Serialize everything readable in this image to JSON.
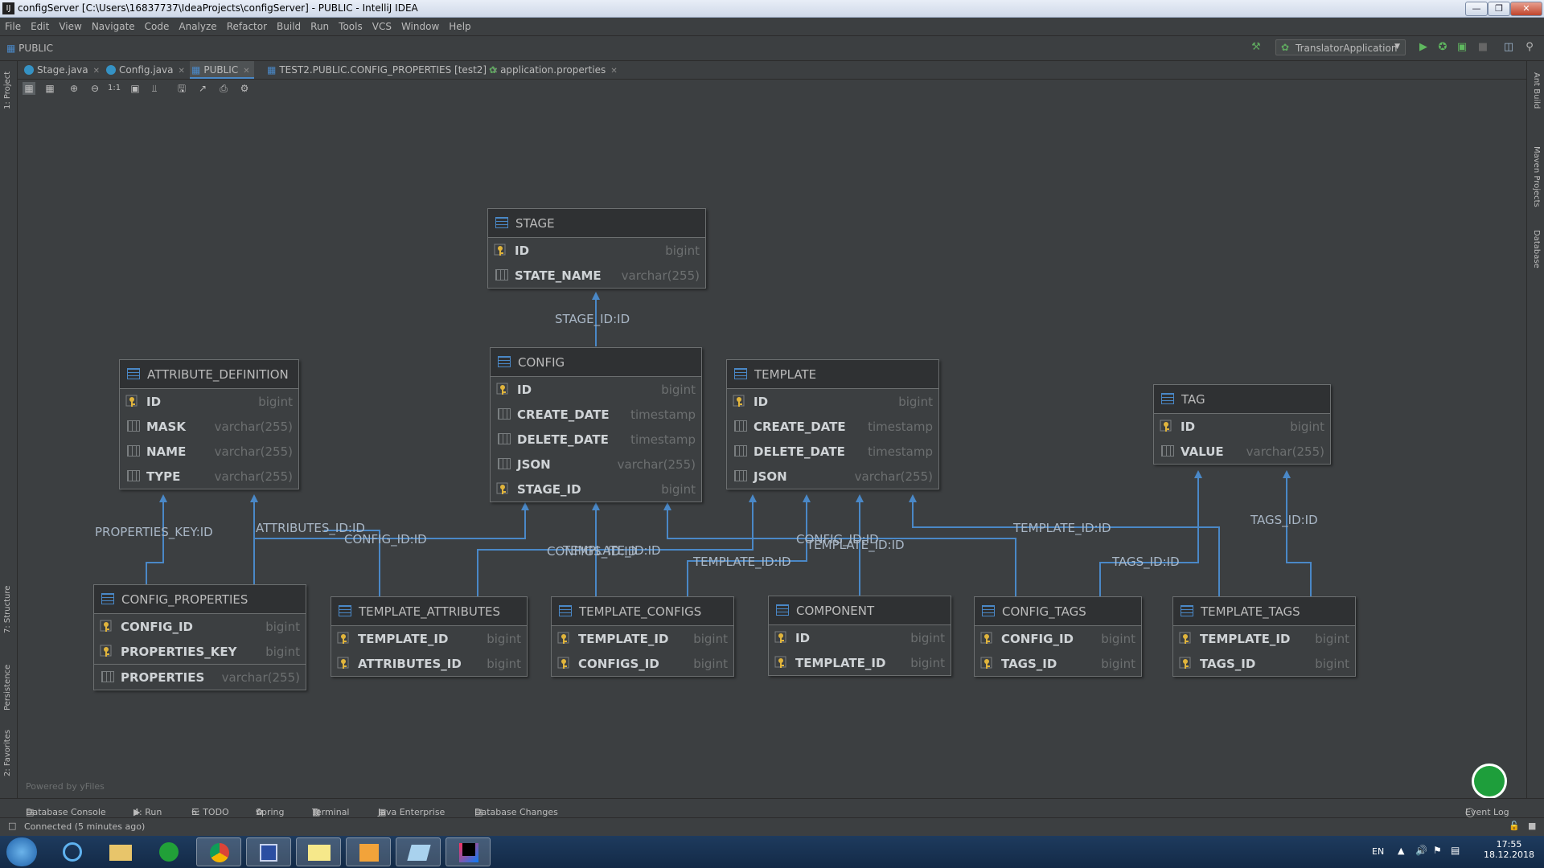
{
  "window": {
    "title": "configServer [C:\\Users\\16837737\\IdeaProjects\\configServer] - PUBLIC - IntelliJ IDEA",
    "app_icon": "IJ",
    "controls": [
      "minimize-icon",
      "restore-icon",
      "close-icon"
    ]
  },
  "menu": [
    "File",
    "Edit",
    "View",
    "Navigate",
    "Code",
    "Analyze",
    "Refactor",
    "Build",
    "Run",
    "Tools",
    "VCS",
    "Window",
    "Help"
  ],
  "navbar": {
    "breadcrumb": "PUBLIC",
    "run_config": "TranslatorApplication"
  },
  "tabs": [
    {
      "label": "Stage.java",
      "icon": "class-icon",
      "active": false
    },
    {
      "label": "Config.java",
      "icon": "class-icon",
      "active": false
    },
    {
      "label": "PUBLIC",
      "icon": "diagram-icon",
      "active": true
    },
    {
      "label": "TEST2.PUBLIC.CONFIG_PROPERTIES [test2]",
      "icon": "table-icon",
      "active": false
    },
    {
      "label": "application.properties",
      "icon": "properties-icon",
      "active": false
    }
  ],
  "diagram_toolbar": {
    "actual_size_label": "1:1"
  },
  "left_strip": [
    "1: Project",
    "7: Structure",
    "Persistence",
    "2: Favorites"
  ],
  "right_strip": [
    "Ant Build",
    "Maven Projects",
    "Database"
  ],
  "canvas": {
    "powered_by": "Powered by yFiles"
  },
  "entities": {
    "stage": {
      "name": "STAGE",
      "columns": [
        {
          "name": "ID",
          "type": "bigint",
          "key": true
        },
        {
          "name": "STATE_NAME",
          "type": "varchar(255)",
          "key": false
        }
      ]
    },
    "config": {
      "name": "CONFIG",
      "columns": [
        {
          "name": "ID",
          "type": "bigint",
          "key": true
        },
        {
          "name": "CREATE_DATE",
          "type": "timestamp",
          "key": false
        },
        {
          "name": "DELETE_DATE",
          "type": "timestamp",
          "key": false
        },
        {
          "name": "JSON",
          "type": "varchar(255)",
          "key": false
        },
        {
          "name": "STAGE_ID",
          "type": "bigint",
          "key": true
        }
      ]
    },
    "template": {
      "name": "TEMPLATE",
      "columns": [
        {
          "name": "ID",
          "type": "bigint",
          "key": true
        },
        {
          "name": "CREATE_DATE",
          "type": "timestamp",
          "key": false
        },
        {
          "name": "DELETE_DATE",
          "type": "timestamp",
          "key": false
        },
        {
          "name": "JSON",
          "type": "varchar(255)",
          "key": false
        }
      ]
    },
    "attribute_definition": {
      "name": "ATTRIBUTE_DEFINITION",
      "columns": [
        {
          "name": "ID",
          "type": "bigint",
          "key": true
        },
        {
          "name": "MASK",
          "type": "varchar(255)",
          "key": false
        },
        {
          "name": "NAME",
          "type": "varchar(255)",
          "key": false
        },
        {
          "name": "TYPE",
          "type": "varchar(255)",
          "key": false
        }
      ]
    },
    "tag": {
      "name": "TAG",
      "columns": [
        {
          "name": "ID",
          "type": "bigint",
          "key": true
        },
        {
          "name": "VALUE",
          "type": "varchar(255)",
          "key": false
        }
      ]
    },
    "config_properties": {
      "name": "CONFIG_PROPERTIES",
      "columns": [
        {
          "name": "CONFIG_ID",
          "type": "bigint",
          "key": true
        },
        {
          "name": "PROPERTIES_KEY",
          "type": "bigint",
          "key": true
        },
        {
          "name": "PROPERTIES",
          "type": "varchar(255)",
          "key": false
        }
      ]
    },
    "template_attributes": {
      "name": "TEMPLATE_ATTRIBUTES",
      "columns": [
        {
          "name": "TEMPLATE_ID",
          "type": "bigint",
          "key": true
        },
        {
          "name": "ATTRIBUTES_ID",
          "type": "bigint",
          "key": true
        }
      ]
    },
    "template_configs": {
      "name": "TEMPLATE_CONFIGS",
      "columns": [
        {
          "name": "TEMPLATE_ID",
          "type": "bigint",
          "key": true
        },
        {
          "name": "CONFIGS_ID",
          "type": "bigint",
          "key": true
        }
      ]
    },
    "component": {
      "name": "COMPONENT",
      "columns": [
        {
          "name": "ID",
          "type": "bigint",
          "key": true
        },
        {
          "name": "TEMPLATE_ID",
          "type": "bigint",
          "key": true
        }
      ]
    },
    "config_tags": {
      "name": "CONFIG_TAGS",
      "columns": [
        {
          "name": "CONFIG_ID",
          "type": "bigint",
          "key": true
        },
        {
          "name": "TAGS_ID",
          "type": "bigint",
          "key": true
        }
      ]
    },
    "template_tags": {
      "name": "TEMPLATE_TAGS",
      "columns": [
        {
          "name": "TEMPLATE_ID",
          "type": "bigint",
          "key": true
        },
        {
          "name": "TAGS_ID",
          "type": "bigint",
          "key": true
        }
      ]
    }
  },
  "edge_labels": {
    "stage_id": "STAGE_ID:ID",
    "properties_key": "PROPERTIES_KEY:ID",
    "attributes_id": "ATTRIBUTES_ID:ID",
    "config_id_props": "CONFIG_ID:ID",
    "configs_id": "CONFIGS_ID:ID",
    "template_id_configs": "TEMPLATE_ID:ID",
    "template_id_attrs": "TEMPLATE_ID:ID",
    "config_id_tags": "CONFIG_ID:ID",
    "template_id_component": "TEMPLATE_ID:ID",
    "template_id_tags": "TEMPLATE_ID:ID",
    "tags_id_config": "TAGS_ID:ID",
    "tags_id_template": "TAGS_ID:ID"
  },
  "tool_windows": [
    "Database Console",
    "4: Run",
    "6: TODO",
    "Spring",
    "Terminal",
    "Java Enterprise",
    "Database Changes",
    "Event Log"
  ],
  "status": "Connected (5 minutes ago)",
  "taskbar": {
    "apps": [
      "start-orb-icon",
      "ie-icon",
      "explorer-icon",
      "sber-icon",
      "chrome-icon",
      "save-icon",
      "notes-icon",
      "outlook-icon",
      "paper-icon",
      "intellij-icon"
    ],
    "lang": "EN",
    "time": "17:55",
    "date": "18.12.2018"
  },
  "colors": {
    "bg": "#3c3f41",
    "edge": "#4a88c7",
    "header": "#2f3133",
    "text": "#bbbbbb"
  }
}
